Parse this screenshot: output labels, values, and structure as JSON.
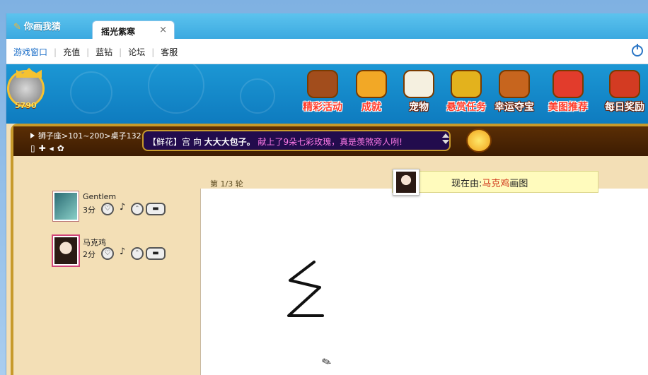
{
  "app": {
    "title": "你画我猜"
  },
  "tab": {
    "label": "摇光紫寒",
    "close": "×"
  },
  "nav": {
    "items": [
      "游戏窗口",
      "充值",
      "蓝钻",
      "论坛",
      "客服"
    ]
  },
  "profile": {
    "level_text": "5790"
  },
  "menu": [
    {
      "label": "精彩活动",
      "icon": "bear-event-icon",
      "red": true
    },
    {
      "label": "成就",
      "icon": "trophy-icon",
      "red": true
    },
    {
      "label": "宠物",
      "icon": "pet-icon",
      "red": false
    },
    {
      "label": "悬赏任务",
      "icon": "gold-task-icon",
      "red": true
    },
    {
      "label": "幸运夺宝",
      "icon": "treasure-icon",
      "red": false
    },
    {
      "label": "美图推荐",
      "icon": "picture-icon",
      "red": true
    },
    {
      "label": "每日奖励",
      "icon": "gift-bag-icon",
      "red": false
    }
  ],
  "room": {
    "path": "狮子座>101~200>桌子132",
    "message": {
      "prefix": "【鲜花】宫 向",
      "target": "大大大包子。",
      "text": "献上了9朵七彩玫瑰，真是羡煞旁人咧!"
    }
  },
  "round": {
    "label": "第 1/3 轮"
  },
  "drawer": {
    "prefix": "现在由:",
    "name": "马克鸡",
    "suffix": "画图"
  },
  "players": [
    {
      "name": "Gentlem",
      "score": "3分"
    },
    {
      "name": "马克鸡",
      "score": "2分"
    }
  ],
  "colors": {
    "accent": "#1d6fc8",
    "tab_bg": "#3ba9e0",
    "frame": "#c79a2b",
    "drawer_name": "#d0371a"
  }
}
